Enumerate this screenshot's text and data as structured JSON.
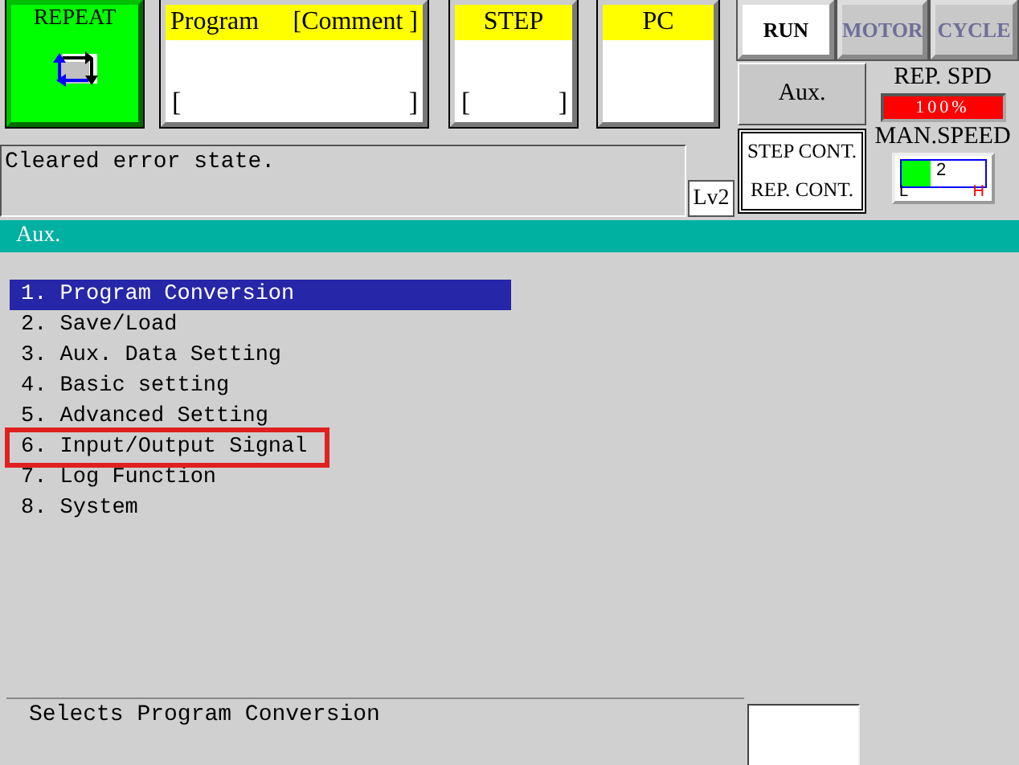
{
  "mode_tile": {
    "label": "REPEAT"
  },
  "info_boxes": [
    {
      "header": "Program",
      "header_note": "[Comment ]",
      "field_open": "[",
      "field_close": "]"
    },
    {
      "header": "STEP",
      "field_open": "[",
      "field_close": "]"
    },
    {
      "header": "PC"
    }
  ],
  "mode_buttons": [
    {
      "label": "RUN",
      "active": true
    },
    {
      "label": "MOTOR",
      "active": false
    },
    {
      "label": "CYCLE",
      "active": false
    }
  ],
  "aux_button": "Aux.",
  "cont_lines": [
    "STEP CONT.",
    "REP. CONT."
  ],
  "rep_speed": {
    "label": "REP. SPD",
    "reading": "100%"
  },
  "man_speed": {
    "label": "MAN.SPEED",
    "level": 0.35,
    "reading": "2",
    "low": "L",
    "high": "H"
  },
  "message": "Cleared error state.",
  "level_badge": "Lv2",
  "section_title": "Aux.",
  "menu": [
    {
      "label": "1. Program Conversion",
      "selected": true,
      "highlighted": false
    },
    {
      "label": "2. Save/Load",
      "selected": false,
      "highlighted": false
    },
    {
      "label": "3. Aux. Data Setting",
      "selected": false,
      "highlighted": false
    },
    {
      "label": "4. Basic setting",
      "selected": false,
      "highlighted": false
    },
    {
      "label": "5. Advanced Setting",
      "selected": false,
      "highlighted": false
    },
    {
      "label": "6. Input/Output Signal",
      "selected": false,
      "highlighted": true
    },
    {
      "label": "7. Log Function",
      "selected": false,
      "highlighted": false
    },
    {
      "label": "8. System",
      "selected": false,
      "highlighted": false
    }
  ],
  "hint": "Selects Program Conversion"
}
